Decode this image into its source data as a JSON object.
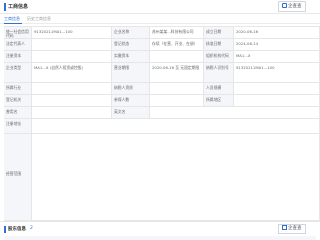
{
  "header": {
    "title": "工商信息",
    "export_label": "企查查"
  },
  "tabs": [
    {
      "label": "工商信息"
    },
    {
      "label": "历史工商信息"
    }
  ],
  "rows": [
    {
      "label1": "统一社会信用代码",
      "value1": "91320211MA1...100",
      "label2": "企业名称",
      "value2": "苏州某某...科技有限公司",
      "label3": "成立日期",
      "value3": "2020-06-16"
    },
    {
      "label1": "法定代表人",
      "value1": "",
      "label2": "登记状态",
      "value2": "存续（在营、开业、在册）",
      "label3": "核准日期",
      "value3": "2024-06-14"
    },
    {
      "label1": "注册资本",
      "value1": "",
      "label2": "实缴资本",
      "value2": "",
      "label3": "组织机构代码",
      "value3": "MA1...X"
    },
    {
      "label1": "企业类型",
      "value1": "MA1...X (自然人投资或控股)",
      "label2": "营业期限",
      "value2": "2020-06-16 至 无固定期限",
      "label3": "纳税人识别号",
      "value3": "91320211MA1...100"
    },
    {
      "label1": "所属行业",
      "value1": "",
      "label2": "纳税人资质",
      "value2": "",
      "label3": "人员规模",
      "value3": ""
    },
    {
      "label1": "登记机关",
      "value1": "",
      "label2": "参保人数",
      "value2": "",
      "label3": "所属地区",
      "value3": ""
    },
    {
      "label1": "曾用名",
      "value1": "",
      "label2": "英文名",
      "value2": "",
      "label3": "",
      "value3": ""
    },
    {
      "label1": "注册地址",
      "value1": "",
      "label2": "",
      "value2": "",
      "label3": "",
      "value3": ""
    }
  ],
  "scope": {
    "label": "经营范围",
    "text": ""
  },
  "section2": {
    "title": "股东信息",
    "count": "2",
    "export_label": "企查查"
  },
  "colors": {
    "accent": "#2f6fd6",
    "label_bg": "#f4f6fa",
    "border": "#e6e6e6"
  }
}
